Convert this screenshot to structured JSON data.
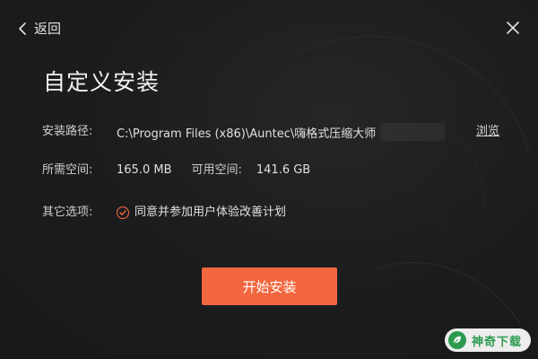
{
  "nav": {
    "back_label": "返回"
  },
  "title": "自定义安装",
  "install_path": {
    "label": "安装路径:",
    "value": "C:\\Program Files (x86)\\Auntec\\嗨格式压缩大师",
    "browse_label": "浏览"
  },
  "space": {
    "required_label": "所需空间:",
    "required_value": "165.0 MB",
    "available_label": "可用空间:",
    "available_value": "141.6 GB"
  },
  "options": {
    "label": "其它选项:",
    "agree_text": "同意并参加用户体验改善计划",
    "agree_checked": true
  },
  "install_button_label": "开始安装",
  "watermark": {
    "text": "神奇下载"
  },
  "colors": {
    "accent": "#f2673f",
    "background": "#1c1c1e",
    "text": "#d6d6d6",
    "watermark_green": "#2b9a4e"
  },
  "icons": {
    "back": "chevron-left-icon",
    "close": "close-icon",
    "checkbox": "check-circle-icon",
    "watermark_logo": "leaf-logo-icon"
  }
}
